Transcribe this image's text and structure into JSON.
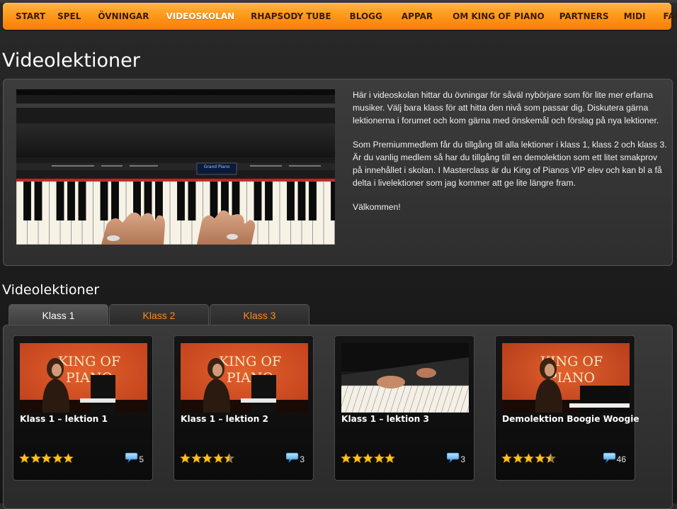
{
  "nav": {
    "items": [
      "START",
      "SPEL",
      "ÖVNINGAR",
      "VIDEOSKOLAN",
      "RHAPSODY TUBE",
      "BLOGG",
      "APPAR",
      "OM  KING OF PIANO",
      "PARTNERS",
      "MIDI",
      "FAQ"
    ],
    "active": "VIDEOSKOLAN"
  },
  "page": {
    "title": "Videolektioner"
  },
  "intro": {
    "video_display": "Grand Piano",
    "paragraphs": [
      "Här i videoskolan hittar du övningar för såväl nybörjare som för lite mer erfarna musiker. Välj bara klass för att hitta den nivå som passar dig. Diskutera gärna lektionerna i forumet och kom gärna med önskemål och förslag på nya lektioner.",
      "Som Premiummedlem får du tillgång till alla lektioner i klass 1, klass 2 och klass 3. Är du vanlig medlem så har du tillgång till en demolektion som ett litet smakprov på innehållet i skolan. I Masterclass är du King of Pianos VIP elev och kan bl a få delta i livelektioner som jag kommer att ge lite längre fram.",
      "Välkommen!"
    ]
  },
  "lessons_section": {
    "title": "Videolektioner",
    "tabs": [
      "Klass 1",
      "Klass 2",
      "Klass 3"
    ],
    "active_tab": "Klass 1",
    "cards": [
      {
        "title": "Klass 1 – lektion 1",
        "rating": 5,
        "comments": "5",
        "thumb_text": "KING OF PIANO",
        "thumb": "presenter-red"
      },
      {
        "title": "Klass 1 – lektion 2",
        "rating": 4.5,
        "comments": "3",
        "thumb_text": "KING OF PIANO",
        "thumb": "presenter-red"
      },
      {
        "title": "Klass 1 – lektion 3",
        "rating": 5,
        "comments": "3",
        "thumb_text": "",
        "thumb": "piano-keys"
      },
      {
        "title": "Demolektion Boogie Woogie",
        "rating": 4.5,
        "comments": "46",
        "thumb_text": "KING OF PIANO",
        "thumb": "presenter-dark"
      }
    ]
  },
  "colors": {
    "nav_orange": "#ff9a1a",
    "tab_inactive_text": "#ff8a1c",
    "background": "#1e1e1e"
  }
}
